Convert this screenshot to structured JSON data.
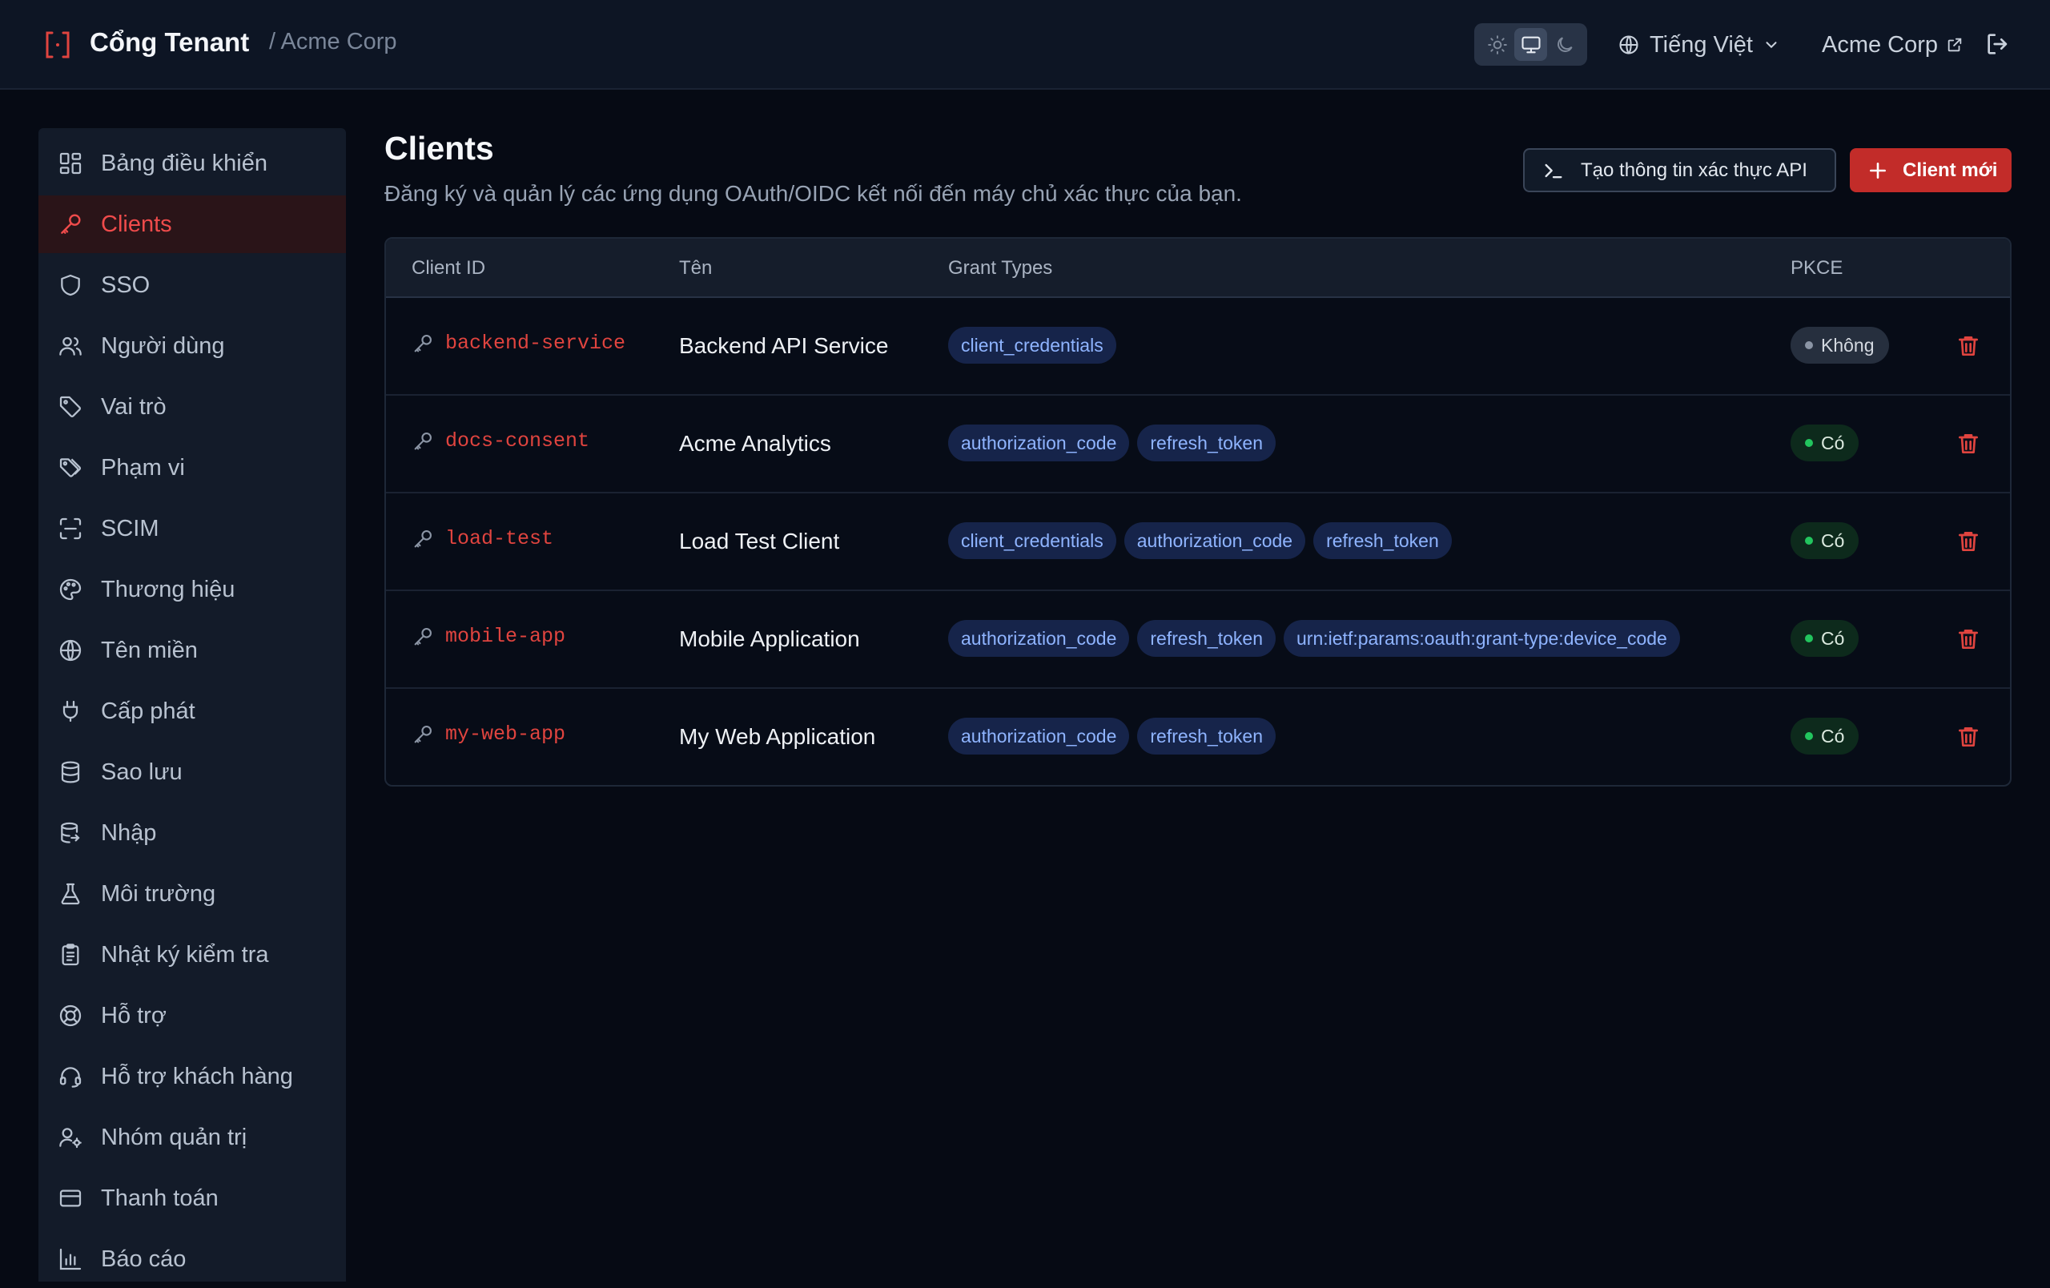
{
  "header": {
    "app_title": "Cổng Tenant",
    "breadcrumb": "/ Acme Corp",
    "theme_modes": [
      "light",
      "system",
      "dark"
    ],
    "theme_active": "system",
    "language": "Tiếng Việt",
    "tenant_link": "Acme Corp"
  },
  "sidebar": {
    "items": [
      {
        "label": "Bảng điều khiển",
        "icon": "dashboard-icon"
      },
      {
        "label": "Clients",
        "icon": "key-icon",
        "active": true
      },
      {
        "label": "SSO",
        "icon": "shield-icon"
      },
      {
        "label": "Người dùng",
        "icon": "users-icon"
      },
      {
        "label": "Vai trò",
        "icon": "tag-icon"
      },
      {
        "label": "Phạm vi",
        "icon": "tags-icon"
      },
      {
        "label": "SCIM",
        "icon": "scan-icon"
      },
      {
        "label": "Thương hiệu",
        "icon": "palette-icon"
      },
      {
        "label": "Tên miền",
        "icon": "globe-icon"
      },
      {
        "label": "Cấp phát",
        "icon": "plug-icon"
      },
      {
        "label": "Sao lưu",
        "icon": "database-icon"
      },
      {
        "label": "Nhập",
        "icon": "database-import-icon"
      },
      {
        "label": "Môi trường",
        "icon": "flask-icon"
      },
      {
        "label": "Nhật ký kiểm tra",
        "icon": "clipboard-icon"
      },
      {
        "label": "Hỗ trợ",
        "icon": "lifebuoy-icon"
      },
      {
        "label": "Hỗ trợ khách hàng",
        "icon": "headset-icon"
      },
      {
        "label": "Nhóm quản trị",
        "icon": "user-cog-icon"
      },
      {
        "label": "Thanh toán",
        "icon": "credit-card-icon"
      },
      {
        "label": "Báo cáo",
        "icon": "bar-chart-icon"
      }
    ]
  },
  "page": {
    "title": "Clients",
    "subtitle": "Đăng ký và quản lý các ứng dụng OAuth/OIDC kết nối đến máy chủ xác thực của bạn.",
    "create_credentials_label": "Tạo thông tin xác thực API",
    "new_client_label": "Client mới"
  },
  "table": {
    "columns": [
      "Client ID",
      "Tên",
      "Grant Types",
      "PKCE"
    ],
    "rows": [
      {
        "client_id": "backend-service",
        "name": "Backend API Service",
        "grants": [
          "client_credentials"
        ],
        "pkce": "Không",
        "pkce_on": false
      },
      {
        "client_id": "docs-consent",
        "name": "Acme Analytics",
        "grants": [
          "authorization_code",
          "refresh_token"
        ],
        "pkce": "Có",
        "pkce_on": true
      },
      {
        "client_id": "load-test",
        "name": "Load Test Client",
        "grants": [
          "client_credentials",
          "authorization_code",
          "refresh_token"
        ],
        "pkce": "Có",
        "pkce_on": true
      },
      {
        "client_id": "mobile-app",
        "name": "Mobile Application",
        "grants": [
          "authorization_code",
          "refresh_token",
          "urn:ietf:params:oauth:grant-type:device_code"
        ],
        "pkce": "Có",
        "pkce_on": true
      },
      {
        "client_id": "my-web-app",
        "name": "My Web Application",
        "grants": [
          "authorization_code",
          "refresh_token"
        ],
        "pkce": "Có",
        "pkce_on": true
      }
    ]
  },
  "colors": {
    "accent": "#ef4b4b",
    "primary_button": "#c22c29",
    "chip_bg": "#16244a",
    "chip_text": "#8fb4ff",
    "pkce_on": "#22c55e"
  }
}
